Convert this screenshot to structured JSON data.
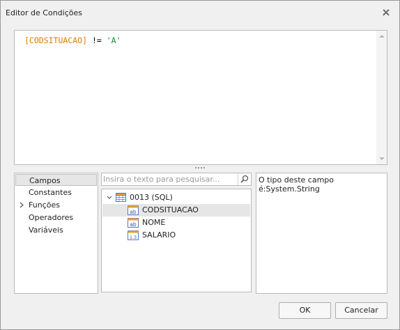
{
  "window": {
    "title": "Editor de Condições",
    "close_icon": "close-icon"
  },
  "editor": {
    "field_token": "[CODSITUACAO]",
    "operator_token": " != ",
    "string_token": "'A'",
    "colors": {
      "field": "#e07b00",
      "operator": "#000000",
      "string": "#0a8a3c"
    }
  },
  "categories": {
    "items": [
      {
        "label": "Campos",
        "selected": true,
        "expandable": false
      },
      {
        "label": "Constantes",
        "selected": false,
        "expandable": false
      },
      {
        "label": "Funções",
        "selected": false,
        "expandable": true
      },
      {
        "label": "Operadores",
        "selected": false,
        "expandable": false
      },
      {
        "label": "Variáveis",
        "selected": false,
        "expandable": false
      }
    ]
  },
  "search": {
    "placeholder": "Insira o texto para pesquisar...",
    "value": "",
    "icon": "search-icon"
  },
  "tree": {
    "root": {
      "label": "0013 (SQL)",
      "icon": "table-icon",
      "expanded": true
    },
    "fields": [
      {
        "label": "CODSITUACAO",
        "icon": "string-field-icon",
        "badge": "ab",
        "selected": true
      },
      {
        "label": "NOME",
        "icon": "string-field-icon",
        "badge": "ab",
        "selected": false
      },
      {
        "label": "SALARIO",
        "icon": "number-field-icon",
        "badge": "1.3",
        "selected": false
      }
    ]
  },
  "info": {
    "text": "O tipo deste campo é:System.String"
  },
  "buttons": {
    "ok_label": "OK",
    "cancel_label": "Cancelar"
  }
}
